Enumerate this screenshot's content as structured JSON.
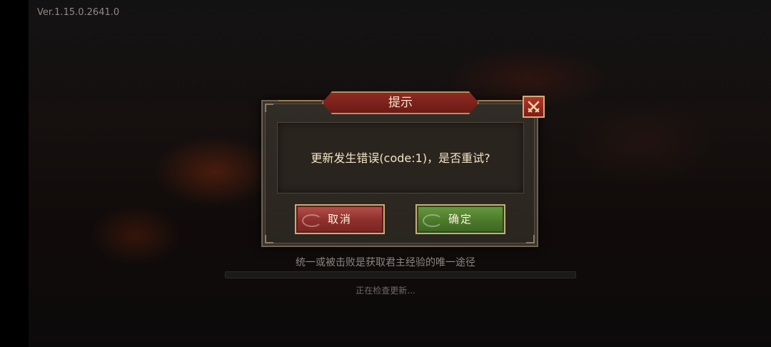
{
  "version": "Ver.1.15.0.2641.0",
  "dialog": {
    "title": "提示",
    "message": "更新发生错误(code:1)，是否重试?",
    "cancel_label": "取消",
    "confirm_label": "确定",
    "close_icon": "close-crossed-swords-icon"
  },
  "loading": {
    "tip": "统一或被击败是获取君主经验的唯一途径",
    "status": "正在检查更新...",
    "progress": 0
  },
  "colors": {
    "title_plate": "#8e2a22",
    "cancel_button": "#8d2f2b",
    "confirm_button": "#4c7a2b",
    "message_text": "#f2e4c4"
  }
}
